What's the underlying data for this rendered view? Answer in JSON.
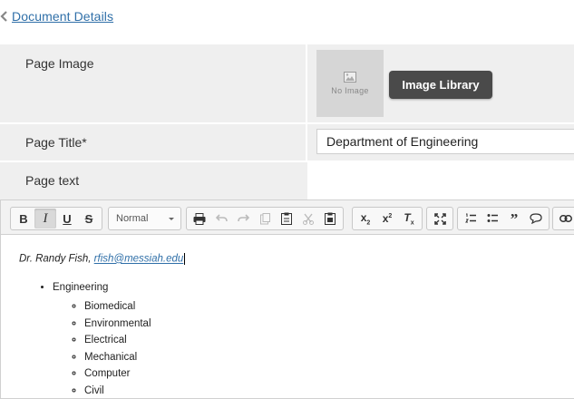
{
  "back_link": {
    "label": "Document Details"
  },
  "form": {
    "page_image": {
      "label": "Page Image",
      "placeholder_text": "No Image",
      "library_button": "Image Library"
    },
    "page_title": {
      "label": "Page Title*",
      "value": "Department of Engineering"
    },
    "page_text": {
      "label": "Page text"
    }
  },
  "toolbar": {
    "format_value": "Normal",
    "icons": [
      "bold-icon",
      "italic-icon",
      "underline-icon",
      "strikethrough-icon",
      "print-icon",
      "undo-icon",
      "redo-icon",
      "paste-icon",
      "paste-text-icon",
      "cut-icon",
      "paste-word-icon",
      "subscript-icon",
      "superscript-icon",
      "remove-format-icon",
      "maximize-icon",
      "numbered-list-icon",
      "bulleted-list-icon",
      "blockquote-icon",
      "speech-bubble-icon",
      "link-icon"
    ]
  },
  "editor": {
    "author": "Dr. Randy Fish,",
    "email": "rfish@messiah.edu",
    "list_heading": "Engineering",
    "sub_items": [
      "Biomedical",
      "Environmental",
      "Electrical",
      "Mechanical",
      "Computer",
      "Civil"
    ]
  },
  "colors": {
    "link": "#2f6fa8",
    "button_dark": "#4a4a4a",
    "row_bg": "#efefef"
  }
}
